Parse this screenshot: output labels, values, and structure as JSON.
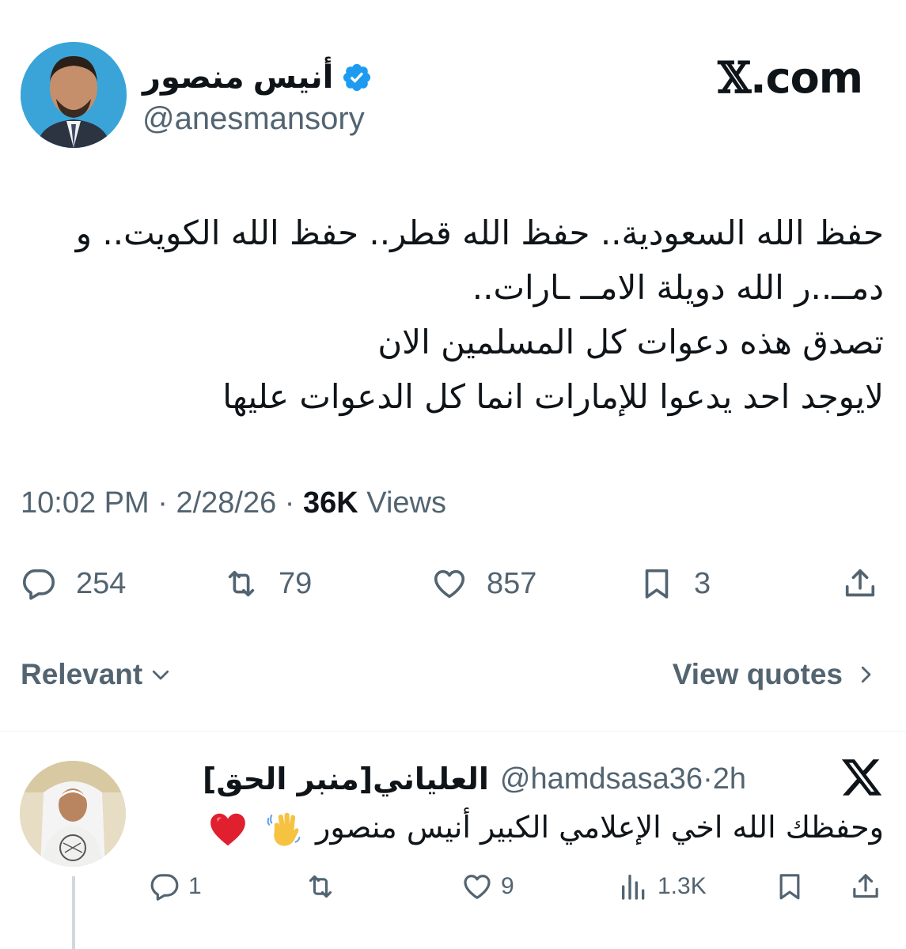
{
  "tweet": {
    "author": {
      "display_name": "أنيس منصور",
      "handle": "@anesmansory",
      "verified": true
    },
    "brand": {
      "x": "𝕏",
      "domain": ".com"
    },
    "text": "حفظ الله السعودية.. حفظ الله قطر.. حفظ الله الكويت.. و\nدمــ..ر الله دويلة الامــ ـارات..\nتصدق هذه دعوات كل المسلمين الان\nلايوجد احد يدعوا للإمارات انما كل الدعوات عليها",
    "meta": {
      "time": "10:02 PM",
      "sep": "·",
      "date": "2/28/26",
      "views_count": "36K",
      "views_label": "Views"
    },
    "actions": {
      "replies": "254",
      "retweets": "79",
      "likes": "857",
      "bookmarks": "3"
    }
  },
  "sort": {
    "label": "Relevant",
    "quotes_label": "View quotes"
  },
  "reply": {
    "display_name": "العلياني[منبر الحق]",
    "handle": "@hamdsasa36",
    "sep": "·",
    "time": "2h",
    "text": "وحفظك الله اخي الإعلامي الكبير أنيس منصور",
    "actions": {
      "replies": "1",
      "likes": "9",
      "views": "1.3K"
    }
  },
  "colors": {
    "text": "#0f1419",
    "secondary": "#536471",
    "verified": "#1d9bf0",
    "divider": "#eff3f4",
    "heart_emoji": "#e0202e",
    "wave_emoji": "#f5c242"
  },
  "icons": {
    "verified": "verified-badge-icon",
    "reply": "speech-bubble-icon",
    "retweet": "retweet-icon",
    "like": "heart-icon",
    "bookmark": "bookmark-icon",
    "share": "share-icon",
    "views": "bar-chart-icon",
    "chevron_down": "chevron-down-icon",
    "chevron_right": "chevron-right-icon",
    "x_logo": "x-logo-icon"
  }
}
